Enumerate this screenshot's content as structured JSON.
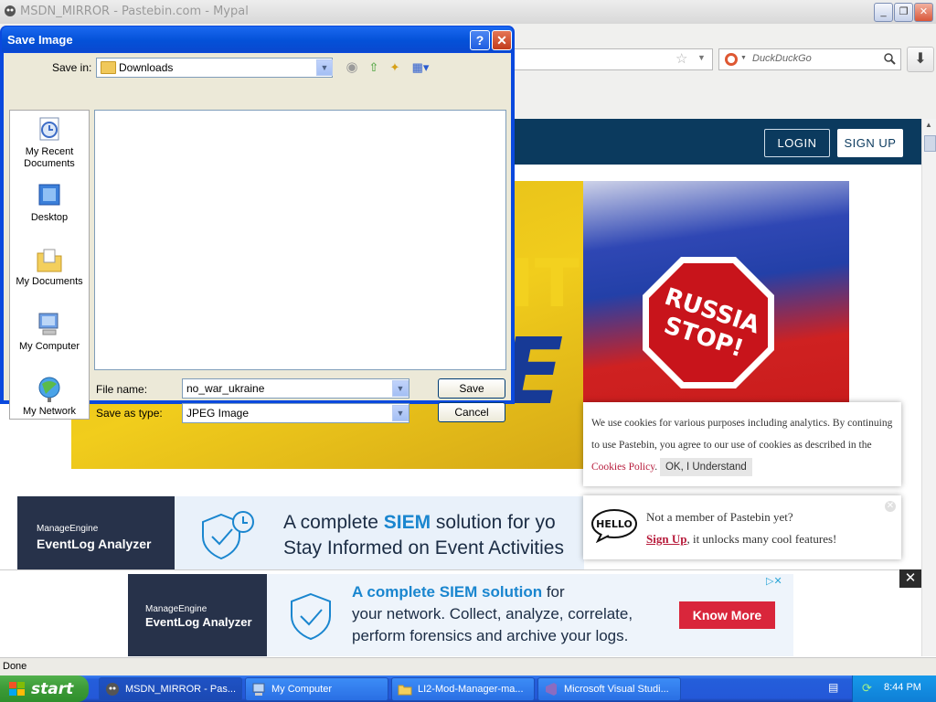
{
  "browser": {
    "title": "MSDN_MIRROR - Pastebin.com - Mypal",
    "search_placeholder": "DuckDuckGo",
    "status": "Done"
  },
  "pastebin": {
    "login": "LOGIN",
    "signup": "SIGN UP",
    "banner": {
      "fragment_top": "IT",
      "fragment_bottom": "E",
      "sign_line1": "RUSSIA",
      "sign_line2": "STOP!"
    },
    "cookie": {
      "text": "We use cookies for various purposes including analytics. By continuing to use Pastebin, you agree to our use of cookies as described in the",
      "link": "Cookies Policy",
      "button": "OK, I Understand"
    },
    "member": {
      "line1": "Not a member of Pastebin yet?",
      "signup": "Sign Up",
      "line2_rest": ", it unlocks many cool features!",
      "hello": "HELLO"
    }
  },
  "ad1": {
    "brand_top": "ManageEngine",
    "brand_main": "EventLog Analyzer",
    "line1_pre": "A complete ",
    "line1_em": "SIEM",
    "line1_post": " solution for yo",
    "line2": "Stay Informed on Event Activities"
  },
  "ad2": {
    "brand_top": "ManageEngine",
    "brand_main": "EventLog Analyzer",
    "line1_em": "A complete SIEM solution",
    "line1_post": " for",
    "line2": "your network. Collect, analyze, correlate,",
    "line3": "perform forensics and archive your logs.",
    "cta": "Know More",
    "close": "✕"
  },
  "dialog": {
    "title": "Save Image",
    "save_in_label": "Save in:",
    "save_in_value": "Downloads",
    "places": [
      {
        "label": "My Recent Documents"
      },
      {
        "label": "Desktop"
      },
      {
        "label": "My Documents"
      },
      {
        "label": "My Computer"
      },
      {
        "label": "My Network"
      }
    ],
    "file_name_label": "File name:",
    "file_name_value": "no_war_ukraine",
    "save_as_label": "Save as type:",
    "save_as_value": "JPEG Image",
    "save_button": "Save",
    "cancel_button": "Cancel"
  },
  "taskbar": {
    "start": "start",
    "tasks": [
      {
        "label": "MSDN_MIRROR - Pas..."
      },
      {
        "label": "My Computer"
      },
      {
        "label": "LI2-Mod-Manager-ma..."
      },
      {
        "label": "Microsoft Visual Studi..."
      }
    ],
    "clock": "8:44 PM"
  }
}
